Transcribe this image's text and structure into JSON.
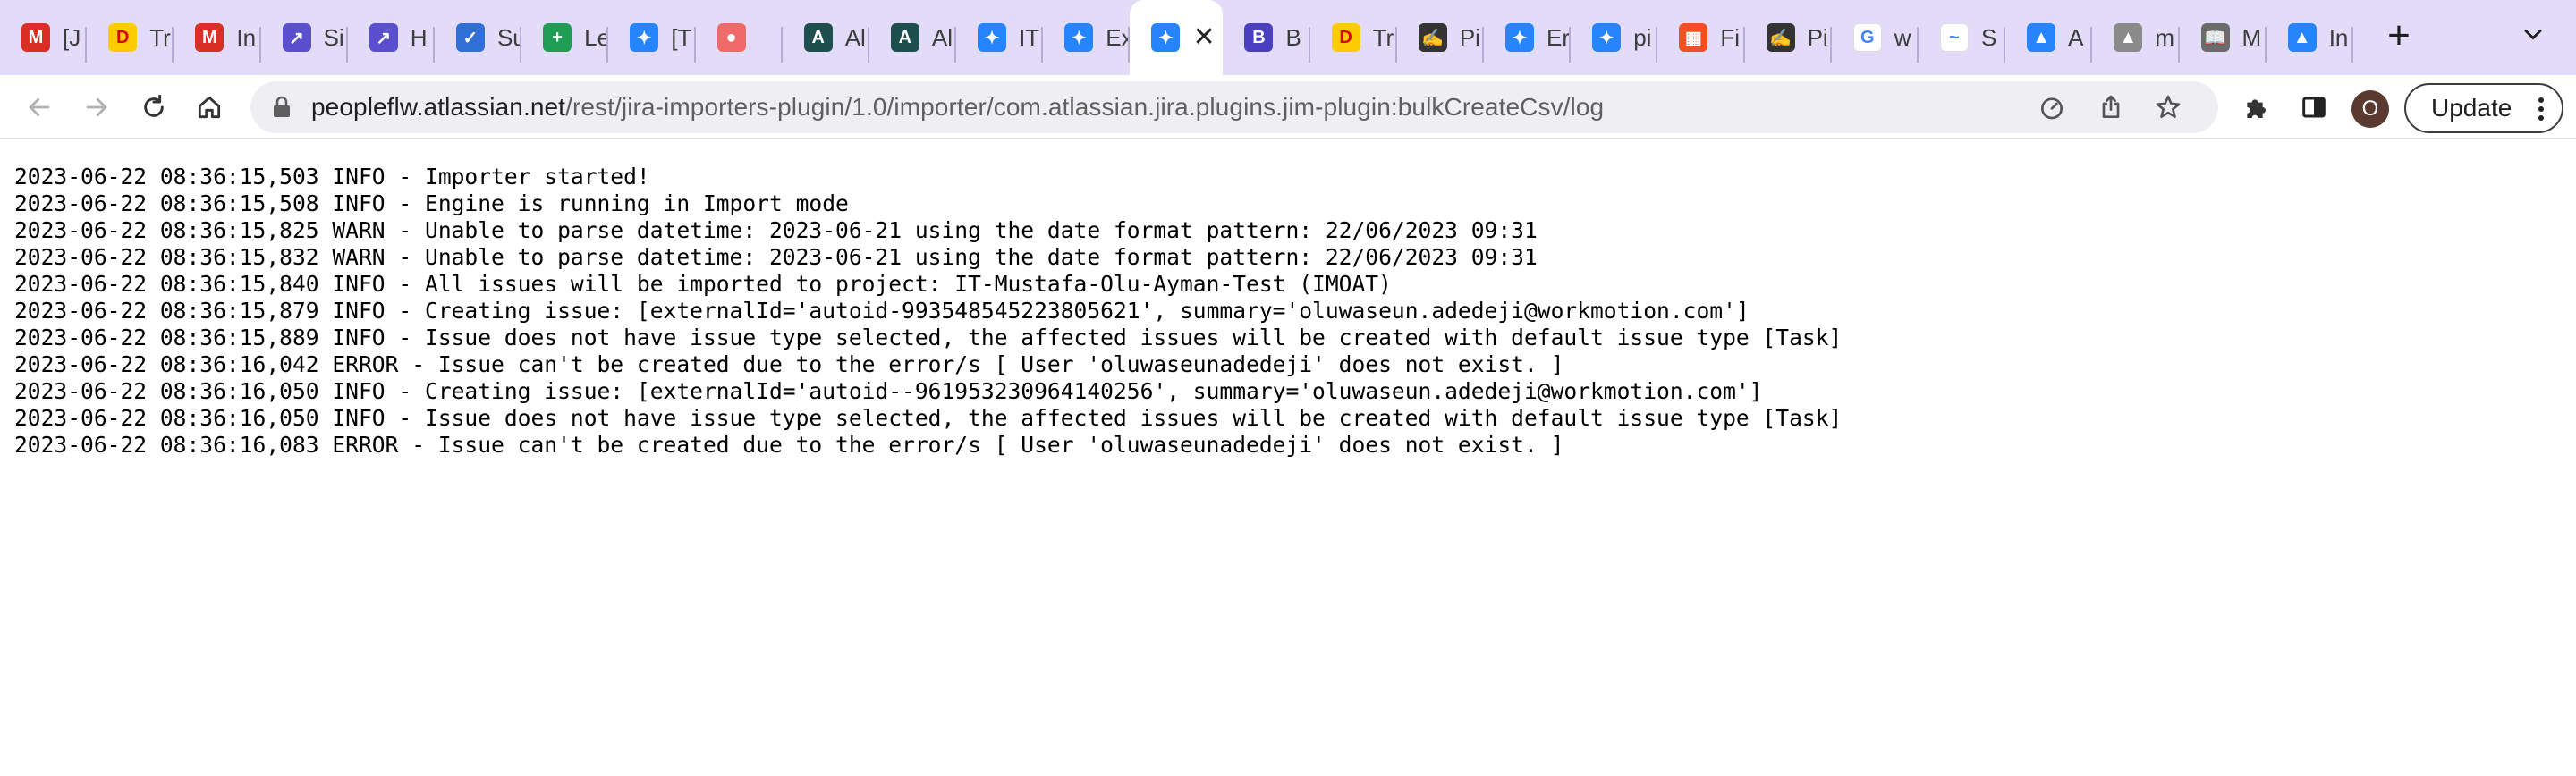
{
  "browser": {
    "tabs": [
      {
        "title": "[J",
        "icon": "gmail-icon",
        "color": "#d93025",
        "glyph": "M"
      },
      {
        "title": "Tr",
        "icon": "dhl-icon",
        "color": "#fccc00",
        "glyph": "D"
      },
      {
        "title": "In",
        "icon": "gmail-icon",
        "color": "#d93025",
        "glyph": "M"
      },
      {
        "title": "Si",
        "icon": "arrow-link-icon",
        "color": "#5a4fcf",
        "glyph": "↗"
      },
      {
        "title": "H",
        "icon": "arrow-link-icon",
        "color": "#5a4fcf",
        "glyph": "↗"
      },
      {
        "title": "Su",
        "icon": "shield-icon",
        "color": "#2f6fd6",
        "glyph": "✓"
      },
      {
        "title": "Le",
        "icon": "sheets-icon",
        "color": "#1f9d55",
        "glyph": "+"
      },
      {
        "title": "[T",
        "icon": "jira-icon",
        "color": "#2684ff",
        "glyph": "✦"
      },
      {
        "title": "",
        "icon": "asana-icon",
        "color": "#f06a6a",
        "glyph": "●"
      },
      {
        "title": "Al",
        "icon": "app-icon",
        "color": "#1e4e4e",
        "glyph": "A"
      },
      {
        "title": "Al",
        "icon": "app-icon",
        "color": "#1e4e4e",
        "glyph": "A"
      },
      {
        "title": "IT",
        "icon": "jira-icon",
        "color": "#2684ff",
        "glyph": "✦"
      },
      {
        "title": "Ex",
        "icon": "jira-icon",
        "color": "#2684ff",
        "glyph": "✦"
      },
      {
        "title": "",
        "icon": "jira-icon",
        "color": "#2684ff",
        "glyph": "✦",
        "active": true
      },
      {
        "title": "B",
        "icon": "app-icon",
        "color": "#4a3fbf",
        "glyph": "B"
      },
      {
        "title": "Tr",
        "icon": "dhl-icon",
        "color": "#fccc00",
        "glyph": "D"
      },
      {
        "title": "Pi",
        "icon": "signature-icon",
        "color": "#333333",
        "glyph": "✍"
      },
      {
        "title": "Er",
        "icon": "jira-icon",
        "color": "#2684ff",
        "glyph": "✦"
      },
      {
        "title": "pi",
        "icon": "jira-icon",
        "color": "#2684ff",
        "glyph": "✦"
      },
      {
        "title": "Fi",
        "icon": "microsoft-icon",
        "color": "#f25022",
        "glyph": "▦"
      },
      {
        "title": "Pi",
        "icon": "signature-icon",
        "color": "#333333",
        "glyph": "✍"
      },
      {
        "title": "w",
        "icon": "google-icon",
        "color": "#ffffff",
        "glyph": "G"
      },
      {
        "title": "S",
        "icon": "app-icon",
        "color": "#ffffff",
        "glyph": "~"
      },
      {
        "title": "A",
        "icon": "atlassian-icon",
        "color": "#2684ff",
        "glyph": "▲"
      },
      {
        "title": "m",
        "icon": "atlassian-icon",
        "color": "#8a8a8a",
        "glyph": "▲"
      },
      {
        "title": "M",
        "icon": "book-icon",
        "color": "#6b6b6b",
        "glyph": "📖"
      },
      {
        "title": "In",
        "icon": "atlassian-icon",
        "color": "#2684ff",
        "glyph": "▲"
      }
    ],
    "url": {
      "host": "peopleflw.atlassian.net",
      "path": "/rest/jira-importers-plugin/1.0/importer/com.atlassian.jira.plugins.jim-plugin:bulkCreateCsv/log"
    },
    "profile_initial": "O",
    "update_label": "Update"
  },
  "log_lines": [
    "2023-06-22 08:36:15,503 INFO - Importer started!",
    "2023-06-22 08:36:15,508 INFO - Engine is running in Import mode",
    "2023-06-22 08:36:15,825 WARN - Unable to parse datetime: 2023-06-21 using the date format pattern: 22/06/2023 09:31",
    "2023-06-22 08:36:15,832 WARN - Unable to parse datetime: 2023-06-21 using the date format pattern: 22/06/2023 09:31",
    "2023-06-22 08:36:15,840 INFO - All issues will be imported to project: IT-Mustafa-Olu-Ayman-Test (IMOAT)",
    "2023-06-22 08:36:15,879 INFO - Creating issue: [externalId='autoid-993548545223805621', summary='oluwaseun.adedeji@workmotion.com']",
    "2023-06-22 08:36:15,889 INFO - Issue does not have issue type selected, the affected issues will be created with default issue type [Task]",
    "2023-06-22 08:36:16,042 ERROR - Issue can't be created due to the error/s [ User 'oluwaseunadedeji' does not exist. ]",
    "2023-06-22 08:36:16,050 INFO - Creating issue: [externalId='autoid--961953230964140256', summary='oluwaseun.adedeji@workmotion.com']",
    "2023-06-22 08:36:16,050 INFO - Issue does not have issue type selected, the affected issues will be created with default issue type [Task]",
    "2023-06-22 08:36:16,083 ERROR - Issue can't be created due to the error/s [ User 'oluwaseunadedeji' does not exist. ]"
  ]
}
